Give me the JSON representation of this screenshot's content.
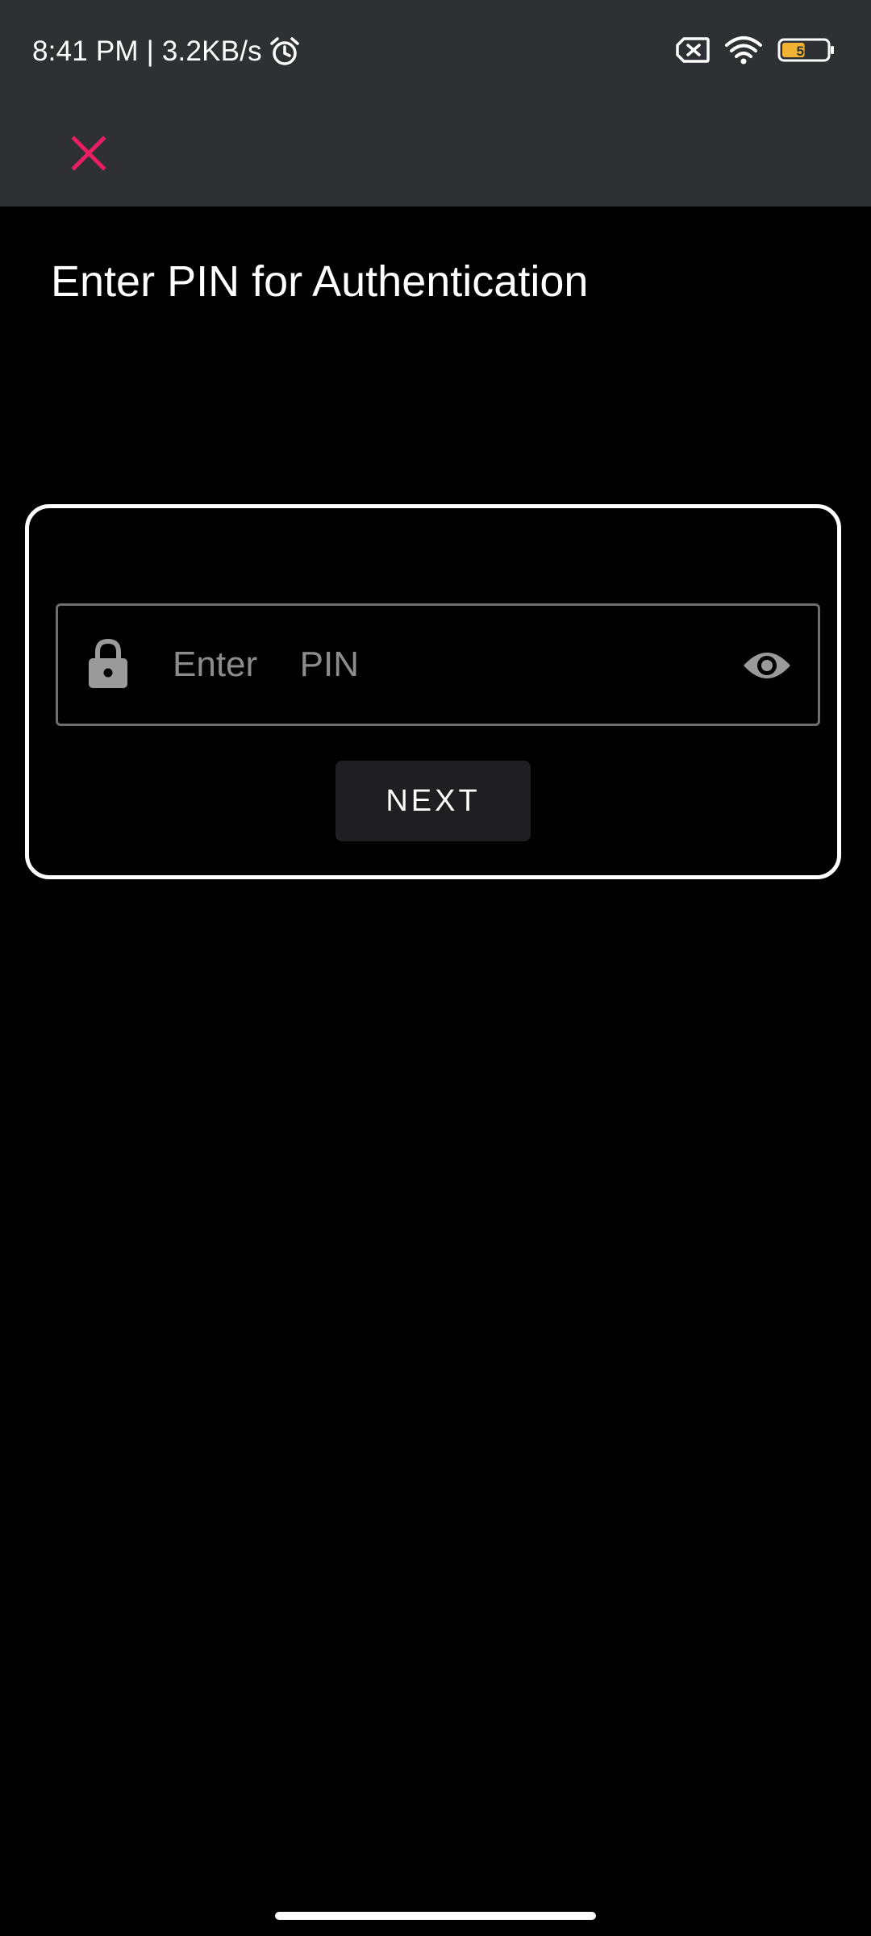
{
  "status_bar": {
    "time_speed": "8:41 PM | 3.2KB/s",
    "alarm_icon": "alarm-icon",
    "sim_icon": "no-sim-icon",
    "wifi_icon": "wifi-icon",
    "battery_level": "51",
    "battery_fraction": 0.51,
    "battery_accent": "#f2b233"
  },
  "app_bar": {
    "close_icon": "close-icon",
    "close_color": "#e91e63"
  },
  "page": {
    "title": "Enter PIN for Authentication"
  },
  "pin_form": {
    "lock_icon": "lock-icon",
    "pin_placeholder": "Enter  PIN",
    "pin_value": "",
    "visibility_icon": "eye-icon",
    "next_label": "NEXT"
  }
}
